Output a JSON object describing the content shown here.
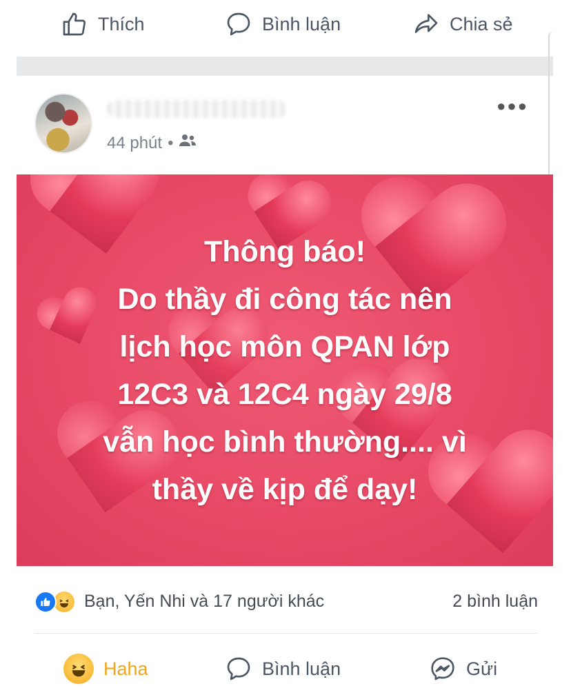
{
  "top_actions": {
    "like": "Thích",
    "comment": "Bình luận",
    "share": "Chia sẻ"
  },
  "post": {
    "time": "44 phút",
    "image_text": [
      "Thông báo!",
      "Do thầy đi công tác nên",
      "lịch học môn QPAN lớp",
      "12C3 và 12C4 ngày 29/8",
      "vẫn học bình thường.... vì",
      "thầy về kịp để dạy!"
    ]
  },
  "stats": {
    "reactions_text": "Bạn, Yến Nhi và 17 người khác",
    "comments_text": "2 bình luận"
  },
  "bottom_actions": {
    "reaction": "Haha",
    "comment": "Bình luận",
    "send": "Gửi"
  },
  "colors": {
    "accent_like": "#1877f2",
    "haha": "#f0a51a",
    "image_bg": "#e84a66"
  }
}
